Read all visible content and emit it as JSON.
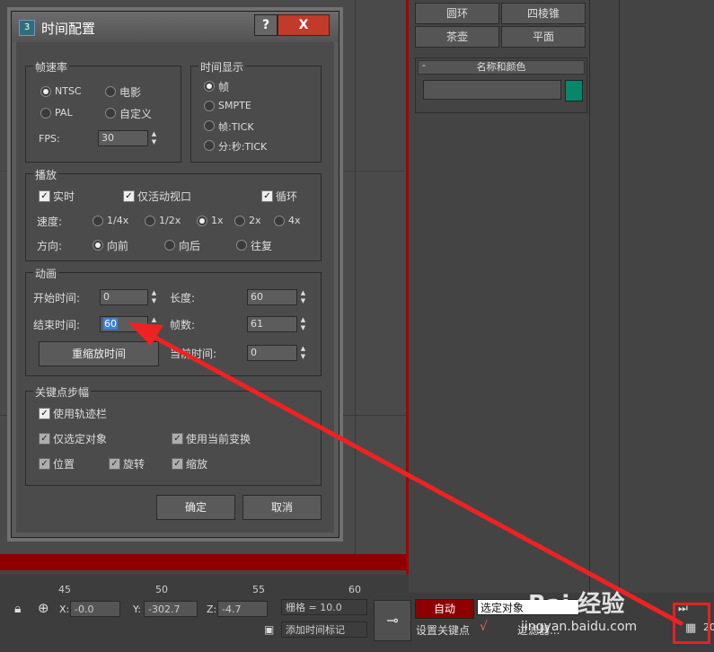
{
  "command_panel": {
    "buttons": [
      "圆环",
      "四棱锥",
      "茶壶",
      "平面"
    ],
    "rollout_title": "名称和颜色",
    "rollout_minus": "-",
    "color": "#07866c"
  },
  "ruler": {
    "ticks": [
      "45",
      "50",
      "55",
      "60"
    ]
  },
  "status_bar": {
    "x_label": "X:",
    "x_value": "-0.0",
    "y_label": "Y:",
    "y_value": "-302.7",
    "z_label": "Z:",
    "z_value": "-4.7",
    "grid": "栅格 = 10.0",
    "auto_key": "自动",
    "selection_set": "选定对象",
    "set_key": "设置关键点",
    "filters": "过滤器...",
    "add_time_tag": "添加时间标记",
    "page_num": "20"
  },
  "watermark": {
    "main": "Bai 经验",
    "url": "jingyan.baidu.com"
  },
  "dialog": {
    "title": "时间配置",
    "help_label": "?",
    "close_label": "X",
    "frame_rate": {
      "title": "帧速率",
      "options": [
        "NTSC",
        "电影",
        "PAL",
        "自定义"
      ],
      "selected": "NTSC",
      "fps_label": "FPS:",
      "fps_value": "30"
    },
    "time_display": {
      "title": "时间显示",
      "options": [
        "帧",
        "SMPTE",
        "帧:TICK",
        "分:秒:TICK"
      ],
      "selected": "帧"
    },
    "playback": {
      "title": "播放",
      "realtime": "实时",
      "active_viewport": "仅活动视口",
      "loop": "循环",
      "speed_label": "速度:",
      "speeds": [
        "1/4x",
        "1/2x",
        "1x",
        "2x",
        "4x"
      ],
      "speed_selected": "1x",
      "direction_label": "方向:",
      "directions": [
        "向前",
        "向后",
        "往复"
      ],
      "direction_selected": "向前"
    },
    "animation": {
      "title": "动画",
      "start_label": "开始时间:",
      "start_value": "0",
      "end_label": "结束时间:",
      "end_value": "60",
      "length_label": "长度:",
      "length_value": "60",
      "frames_label": "帧数:",
      "frames_value": "61",
      "rescale_button": "重缩放时间",
      "current_label": "当前时间:",
      "current_value": "0"
    },
    "key_steps": {
      "title": "关键点步幅",
      "use_trackbar": "使用轨迹栏",
      "selected_only": "仅选定对象",
      "use_current_transform": "使用当前变换",
      "position": "位置",
      "rotation": "旋转",
      "scale": "缩放"
    },
    "ok_button": "确定",
    "cancel_button": "取消"
  }
}
